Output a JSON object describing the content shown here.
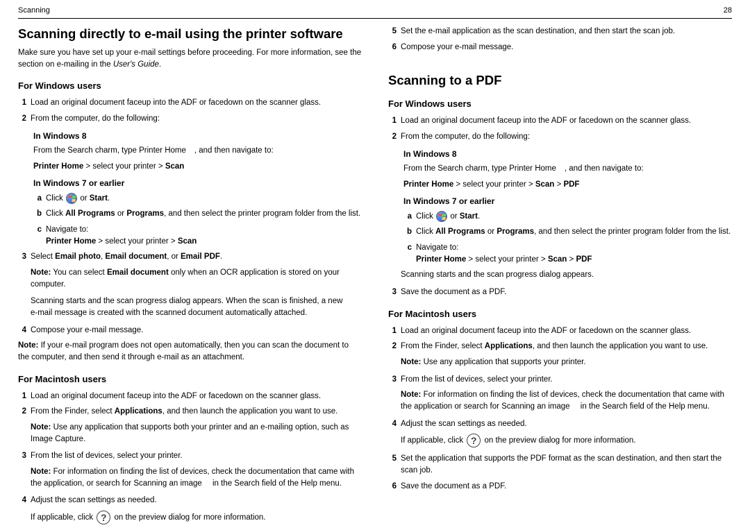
{
  "header": {
    "left": "Scanning",
    "right": "28"
  },
  "left": {
    "title": "Scanning directly to e‑mail using the printer software",
    "intro_a": "Make sure you have set up your e‑mail settings before proceeding. For more information, see the section on e‑mailing in the ",
    "intro_b": "User's Guide",
    "intro_c": ".",
    "win": {
      "heading": "For Windows users",
      "s1": "Load an original document faceup into the ADF or facedown on the scanner glass.",
      "s2": "From the computer, do the following:",
      "w8_head": "In Windows 8",
      "w8_a1": "From the Search charm, type ",
      "w8_a2": "Printer Home",
      "w8_a3": ", and then navigate to:",
      "w8_b1": "Printer Home",
      "w8_b2": " > select your printer > ",
      "w8_b3": "Scan",
      "w7_head": "In Windows 7 or earlier",
      "a_a": "Click ",
      "a_b": " or ",
      "a_c": "Start",
      "a_d": ".",
      "b1": "Click ",
      "b2": "All Programs",
      "b3": " or ",
      "b4": "Programs",
      "b5": ", and then select the printer program folder from the list.",
      "c1": "Navigate to:",
      "c_path_a": "Printer Home",
      "c_path_b": " > select your printer > ",
      "c_path_c": "Scan",
      "s3a": "Select ",
      "s3b": "Email photo",
      "s3c": ", ",
      "s3d": "Email document",
      "s3e": ", or ",
      "s3f": "Email PDF",
      "s3g": ".",
      "note3a": "Note:",
      "note3b": " You can select ",
      "note3c": "Email document",
      "note3d": " only when an OCR application is stored on your computer.",
      "after3": "Scanning starts and the scan progress dialog appears. When the scan is finished, a new e‑mail message is created with the scanned document automatically attached.",
      "s4": "Compose your e‑mail message.",
      "note4a": "Note:",
      "note4b": " If your e-mail program does not open automatically, then you can scan the document to the computer, and then send it through e-mail as an attachment."
    },
    "mac": {
      "heading": "For Macintosh users",
      "s1": "Load an original document faceup into the ADF or facedown on the scanner glass.",
      "s2a": "From the Finder, select ",
      "s2b": "Applications",
      "s2c": ", and then launch the application you want to use.",
      "note2a": "Note:",
      "note2b": " Use any application that supports both your printer and an e‑mailing option, such as Image Capture.",
      "s3": "From the list of devices, select your printer.",
      "note3a": "Note:",
      "note3b": " For information on finding the list of devices, check the documentation that came with the application, or search for ",
      "note3c": "Scanning an image",
      "note3d": " in the Search field of the Help menu.",
      "s4": "Adjust the scan settings as needed.",
      "appl_a": "If applicable, click ",
      "appl_b": " on the preview dialog for more information."
    }
  },
  "right": {
    "cont": {
      "s5": "Set the e‑mail application as the scan destination, and then start the scan job.",
      "s6": "Compose your e‑mail message."
    },
    "title": "Scanning to a PDF",
    "win": {
      "heading": "For Windows users",
      "s1": "Load an original document faceup into the ADF or facedown on the scanner glass.",
      "s2": "From the computer, do the following:",
      "w8_head": "In Windows 8",
      "w8_a1": "From the Search charm, type ",
      "w8_a2": "Printer Home",
      "w8_a3": ", and then navigate to:",
      "w8_b1": "Printer Home",
      "w8_b2": " > select your printer > ",
      "w8_b3": "Scan",
      "w8_b4": " > ",
      "w8_b5": "PDF",
      "w7_head": "In Windows 7 or earlier",
      "a_a": "Click ",
      "a_b": " or ",
      "a_c": "Start",
      "a_d": ".",
      "b1": "Click ",
      "b2": "All Programs",
      "b3": " or ",
      "b4": "Programs",
      "b5": ", and then select the printer program folder from the list.",
      "c1": "Navigate to:",
      "c_path_a": "Printer Home",
      "c_path_b": " > select your printer > ",
      "c_path_c": "Scan",
      "c_path_d": " > ",
      "c_path_e": "PDF",
      "after": "Scanning starts and the scan progress dialog appears.",
      "s3": "Save the document as a PDF."
    },
    "mac": {
      "heading": "For Macintosh users",
      "s1": "Load an original document faceup into the ADF or facedown on the scanner glass.",
      "s2a": "From the Finder, select ",
      "s2b": "Applications",
      "s2c": ", and then launch the application you want to use.",
      "note2a": "Note:",
      "note2b": " Use any application that supports your printer.",
      "s3": "From the list of devices, select your printer.",
      "note3a": "Note:",
      "note3b": " For information on finding the list of devices, check the documentation that came with the application or search for ",
      "note3c": "Scanning an image",
      "note3d": " in the Search field of the Help menu.",
      "s4": "Adjust the scan settings as needed.",
      "appl_a": "If applicable, click ",
      "appl_b": " on the preview dialog for more information.",
      "s5": "Set the application that supports the PDF format as the scan destination, and then start the scan job.",
      "s6": "Save the document as a PDF."
    }
  },
  "labels": {
    "a": "a",
    "b": "b",
    "c": "c",
    "n1": "1",
    "n2": "2",
    "n3": "3",
    "n4": "4",
    "n5": "5",
    "n6": "6",
    "q": "?"
  }
}
